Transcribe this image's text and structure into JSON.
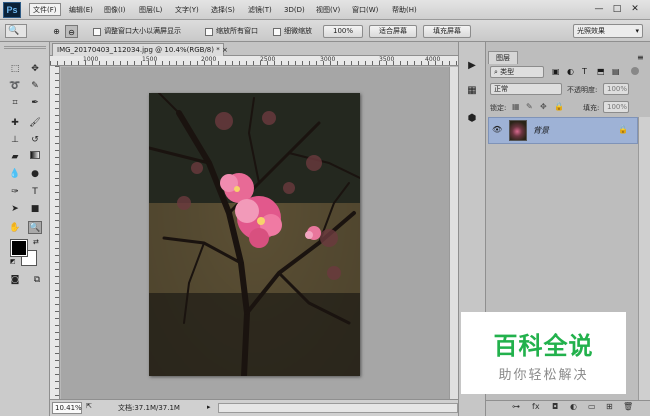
{
  "app": {
    "logo": "Ps"
  },
  "menu": [
    "文件(F)",
    "编辑(E)",
    "图像(I)",
    "图层(L)",
    "文字(Y)",
    "选择(S)",
    "滤镜(T)",
    "3D(D)",
    "视图(V)",
    "窗口(W)",
    "帮助(H)"
  ],
  "window_controls": {
    "minimize": "—",
    "restore": "□",
    "close": "✕"
  },
  "options": {
    "resize_windows": "调整窗口大小以满屏显示",
    "zoom_all": "缩放所有窗口",
    "scrubby_zoom": "细微缩放",
    "btn_100": "100%",
    "btn_fit": "适合屏幕",
    "btn_fill": "填充屏幕",
    "workspace": "光照效果"
  },
  "document": {
    "tab_title": "IMG_20170403_112034.jpg @ 10.4%(RGB/8) *",
    "tab_close": "×",
    "ruler_marks": [
      "1000",
      "1500",
      "2000",
      "2500",
      "3000",
      "3500",
      "4000"
    ],
    "zoom": "10.41%",
    "doc_info": "文档:37.1M/37.1M"
  },
  "layers_panel": {
    "tab": "图层",
    "kind_filter": "类型",
    "blend_mode": "正常",
    "opacity_label": "不透明度:",
    "opacity_value": "100%",
    "lock_label": "锁定:",
    "fill_label": "填充:",
    "fill_value": "100%",
    "layers": [
      {
        "name": "背景",
        "visible": true,
        "locked": true
      }
    ]
  },
  "watermark": {
    "line1": "百科全说",
    "line2": "助你轻松解决"
  },
  "colors": {
    "accent": "#22b14c",
    "selected_layer": "#9eb2d6"
  }
}
